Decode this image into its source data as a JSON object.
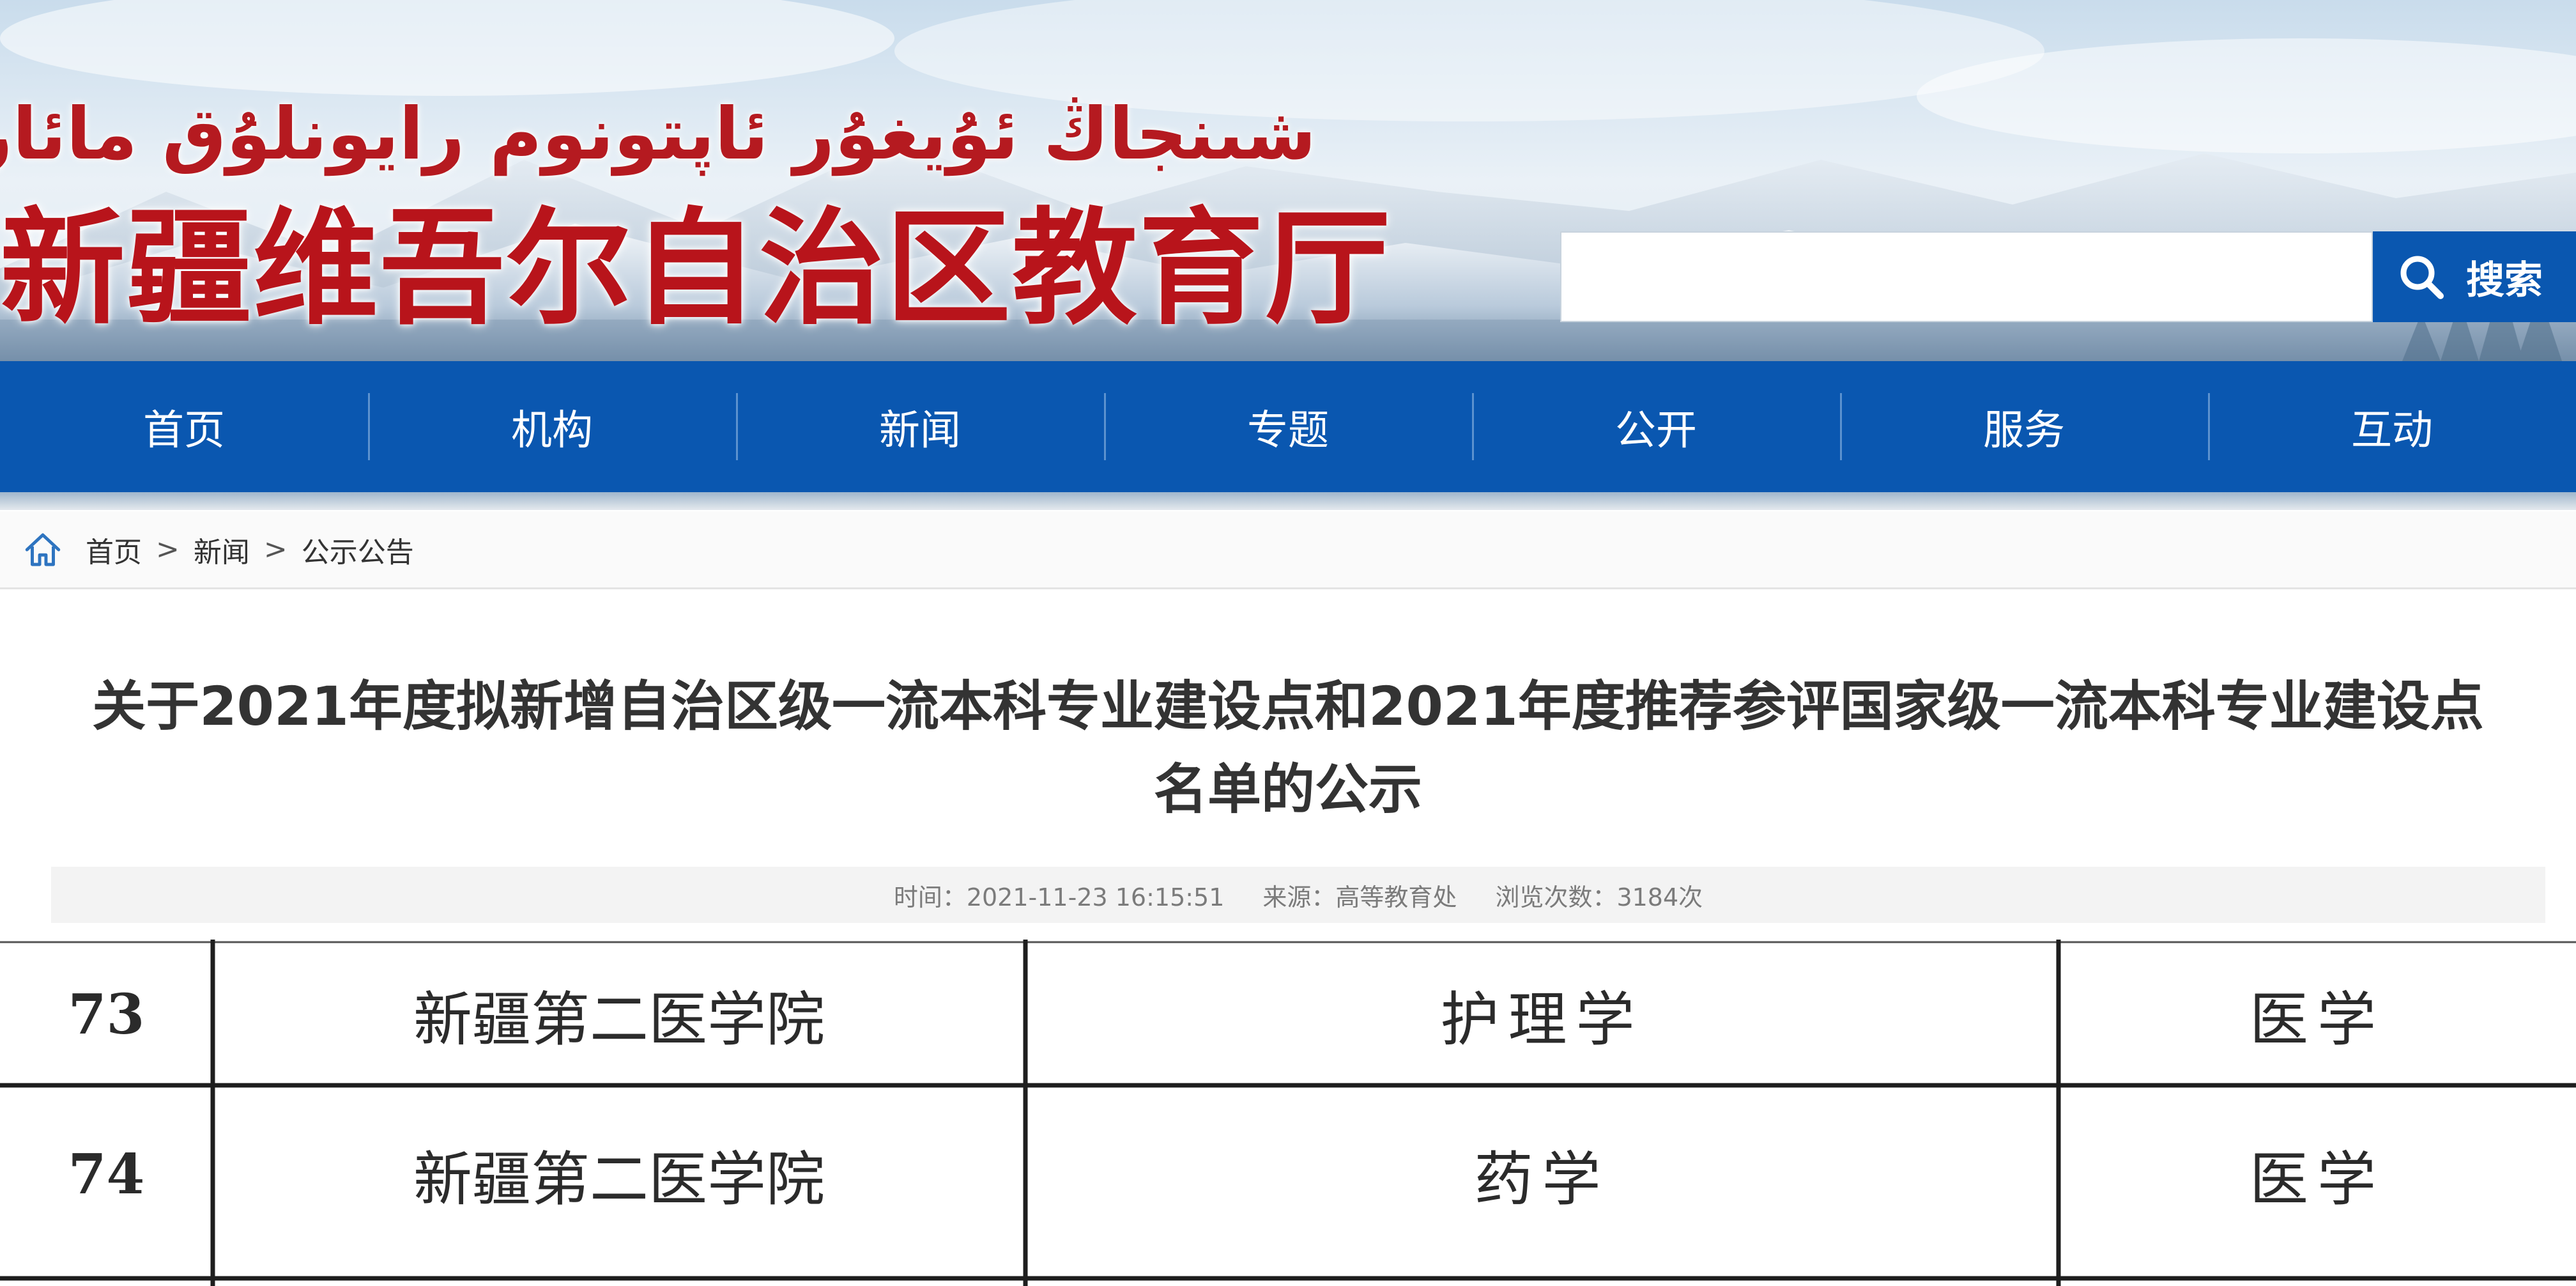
{
  "header": {
    "uyghur_title": "شىنجاڭ ئۇيغۇر ئاپتونوم رايونلۇق مائارىپ نازارىتى",
    "chinese_title": "新疆维吾尔自治区教育厅",
    "search": {
      "placeholder": "",
      "button_label": "搜索",
      "button_icon": "search-icon"
    },
    "colors": {
      "title_red": "#b8141b",
      "brand_blue": "#0a57b0"
    }
  },
  "nav": {
    "items": [
      {
        "label": "首页"
      },
      {
        "label": "机构"
      },
      {
        "label": "新闻"
      },
      {
        "label": "专题"
      },
      {
        "label": "公开"
      },
      {
        "label": "服务"
      },
      {
        "label": "互动"
      }
    ]
  },
  "breadcrumb": {
    "icon": "home-icon",
    "separator": ">",
    "items": [
      {
        "label": "首页"
      },
      {
        "label": "新闻"
      },
      {
        "label": "公示公告"
      }
    ]
  },
  "article": {
    "title_line1": "关于2021年度拟新增自治区级一流本科专业建设点和2021年度推荐参评国家级一流本科专业建设点",
    "title_line2": "名单的公示",
    "meta": {
      "time": "时间：2021-11-23 16:15:51",
      "source": "来源：高等教育处",
      "views": "浏览次数：3184次"
    }
  },
  "table": {
    "rows": [
      {
        "no": "73",
        "school": "新疆第二医学院",
        "major": "护理学",
        "category": "医学"
      },
      {
        "no": "74",
        "school": "新疆第二医学院",
        "major": "药学",
        "category": "医学"
      }
    ]
  }
}
